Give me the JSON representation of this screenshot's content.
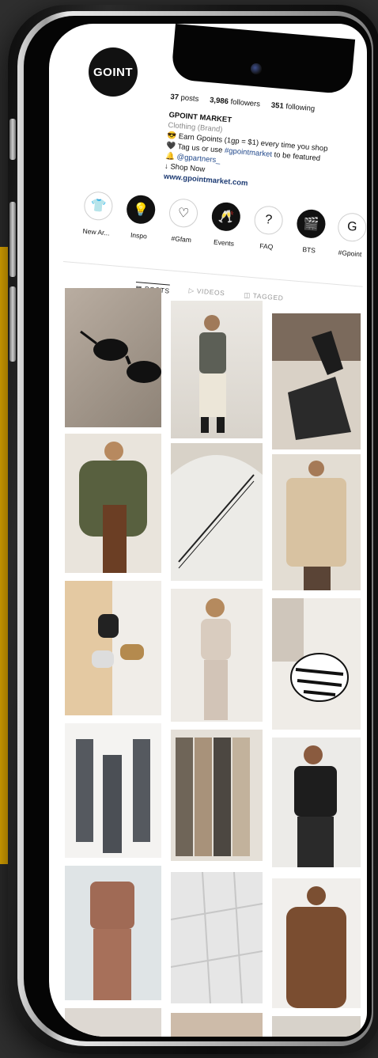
{
  "profile": {
    "logo_text": "GOINT",
    "posts_count": "37",
    "posts_label": "posts",
    "followers_count": "3,986",
    "followers_label": "followers",
    "following_count": "351",
    "following_label": "following",
    "name": "GPOINT MARKET",
    "category": "Clothing (Brand)",
    "bio_line1": "😎 Earn Gpoints (1gp = $1) every time you shop",
    "bio_line2_prefix": "🖤 Tag us or use ",
    "bio_hashtag": "#gpointmarket",
    "bio_line2_suffix": " to be featured",
    "bio_line3_prefix": "🔔 ",
    "bio_mention": "@gpartners_",
    "bio_line4": "↓ Shop Now",
    "website": "www.gpointmarket.com"
  },
  "highlights": [
    {
      "label": "New Ar...",
      "icon": "👕",
      "dark": false
    },
    {
      "label": "Inspo",
      "icon": "💡",
      "dark": true
    },
    {
      "label": "#Gfam",
      "icon": "♡",
      "dark": false
    },
    {
      "label": "Events",
      "icon": "🥂",
      "dark": true
    },
    {
      "label": "FAQ",
      "icon": "?",
      "dark": false
    },
    {
      "label": "BTS",
      "icon": "🎬",
      "dark": true
    },
    {
      "label": "#Gpoint",
      "icon": "G",
      "dark": false
    }
  ],
  "tabs": {
    "posts": "▦ POSTS",
    "videos": "▷ VIDEOS",
    "tagged": "◫ TAGGED"
  },
  "colors": {
    "accent_yellow": "#f5b800",
    "link_blue": "#234a8c"
  }
}
